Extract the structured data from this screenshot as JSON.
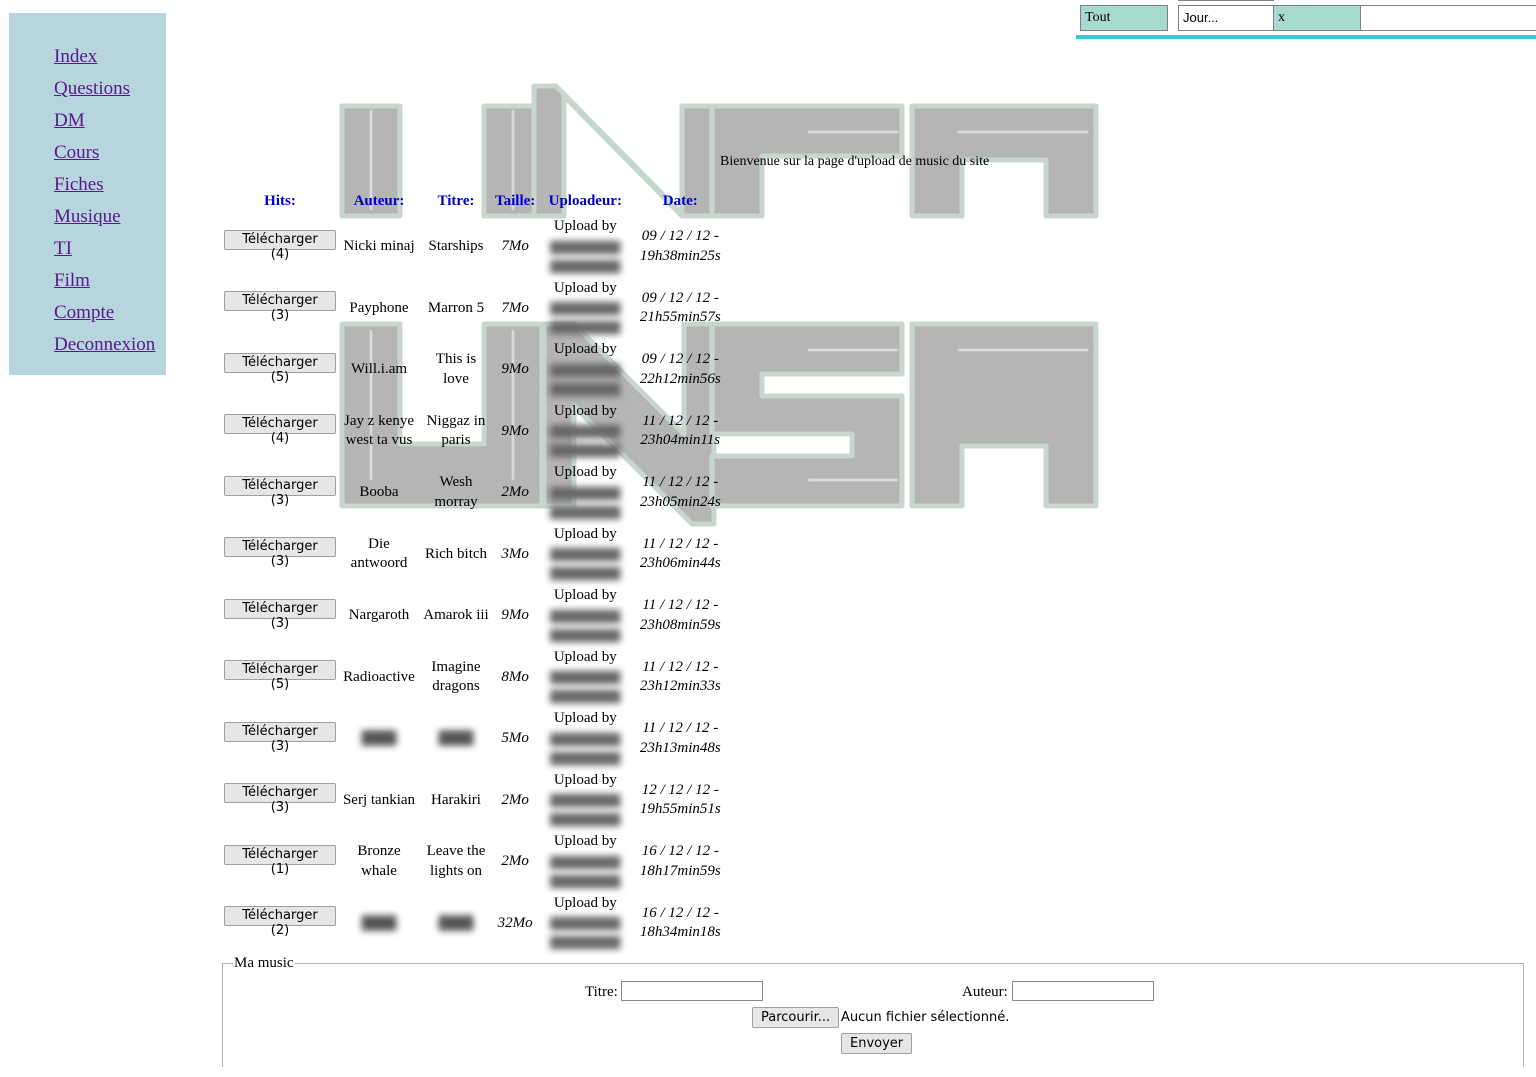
{
  "sidebar": {
    "items": [
      {
        "label": "Index"
      },
      {
        "label": "Questions"
      },
      {
        "label": "DM"
      },
      {
        "label": "Cours"
      },
      {
        "label": "Fiches"
      },
      {
        "label": "Musique"
      },
      {
        "label": "TI"
      },
      {
        "label": "Film"
      },
      {
        "label": "Compte"
      },
      {
        "label": "Deconnexion"
      }
    ]
  },
  "topbar": {
    "tout": "Tout",
    "jour": "Jour...",
    "x": "x"
  },
  "logo_text": "UNSA",
  "welcome": "Bienvenue sur la page d'upload de music du site",
  "table": {
    "headers": {
      "hits": "Hits:",
      "auteur": "Auteur:",
      "titre": "Titre:",
      "taille": "Taille:",
      "uploadeur": "Uploadeur:",
      "date": "Date:"
    },
    "rows": [
      {
        "hits": "Télécharger (4)",
        "auteur": "Nicki minaj",
        "titre": "Starships",
        "taille": "7Mo",
        "upload": "Upload by",
        "date": "09 / 12 / 12 - 19h38min25s"
      },
      {
        "hits": "Télécharger (3)",
        "auteur": "Payphone",
        "titre": "Marron 5",
        "taille": "7Mo",
        "upload": "Upload by",
        "date": "09 / 12 / 12 - 21h55min57s"
      },
      {
        "hits": "Télécharger (5)",
        "auteur": "Will.i.am",
        "titre": "This is love",
        "taille": "9Mo",
        "upload": "Upload by",
        "date": "09 / 12 / 12 - 22h12min56s"
      },
      {
        "hits": "Télécharger (4)",
        "auteur": "Jay z kenye west ta vus",
        "titre": "Niggaz in paris",
        "taille": "9Mo",
        "upload": "Upload by",
        "date": "11 / 12 / 12 - 23h04min11s"
      },
      {
        "hits": "Télécharger (3)",
        "auteur": "Booba",
        "titre": "Wesh morray",
        "taille": "2Mo",
        "upload": "Upload by",
        "date": "11 / 12 / 12 - 23h05min24s"
      },
      {
        "hits": "Télécharger (3)",
        "auteur": "Die antwoord",
        "titre": "Rich bitch",
        "taille": "3Mo",
        "upload": "Upload by",
        "date": "11 / 12 / 12 - 23h06min44s"
      },
      {
        "hits": "Télécharger (3)",
        "auteur": "Nargaroth",
        "titre": "Amarok iii",
        "taille": "9Mo",
        "upload": "Upload by",
        "date": "11 / 12 / 12 - 23h08min59s"
      },
      {
        "hits": "Télécharger (5)",
        "auteur": "Radioactive",
        "titre": "Imagine dragons",
        "taille": "8Mo",
        "upload": "Upload by",
        "date": "11 / 12 / 12 - 23h12min33s"
      },
      {
        "hits": "Télécharger (3)",
        "auteur": "",
        "titre": "",
        "taille": "5Mo",
        "upload": "Upload by",
        "date": "11 / 12 / 12 - 23h13min48s"
      },
      {
        "hits": "Télécharger (3)",
        "auteur": "Serj tankian",
        "titre": "Harakiri",
        "taille": "2Mo",
        "upload": "Upload by",
        "date": "12 / 12 / 12 - 19h55min51s"
      },
      {
        "hits": "Télécharger (1)",
        "auteur": "Bronze whale",
        "titre": "Leave the lights on",
        "taille": "2Mo",
        "upload": "Upload by",
        "date": "16 / 12 / 12 - 18h17min59s"
      },
      {
        "hits": "Télécharger (2)",
        "auteur": "",
        "titre": "",
        "taille": "32Mo",
        "upload": "Upload by",
        "date": "16 / 12 / 12 - 18h34min18s"
      }
    ]
  },
  "form": {
    "legend": "Ma music",
    "titre_label": "Titre:",
    "auteur_label": "Auteur:",
    "browse_label": "Parcourir...",
    "no_file": "Aucun fichier sélectionné.",
    "submit_label": "Envoyer"
  }
}
